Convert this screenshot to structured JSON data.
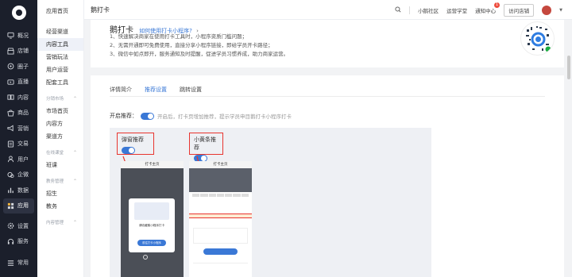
{
  "nav": {
    "items": [
      {
        "icon": "monitor-icon",
        "label": "概况"
      },
      {
        "icon": "store-icon",
        "label": "店铺"
      },
      {
        "icon": "group-icon",
        "label": "圈子"
      },
      {
        "icon": "live-icon",
        "label": "直播"
      },
      {
        "icon": "book-icon",
        "label": "内容"
      },
      {
        "icon": "goods-icon",
        "label": "商品"
      },
      {
        "icon": "marketing-icon",
        "label": "营销"
      },
      {
        "icon": "transaction-icon",
        "label": "交易"
      },
      {
        "icon": "user-icon",
        "label": "用户"
      },
      {
        "icon": "enterprise-wechat-icon",
        "label": "企微"
      },
      {
        "icon": "data-icon",
        "label": "数据"
      },
      {
        "icon": "apps-icon",
        "label": "应用"
      },
      {
        "icon": "settings-icon",
        "label": "设置"
      },
      {
        "icon": "service-icon",
        "label": "服务"
      }
    ],
    "bottom": {
      "icon": "menu-icon",
      "label": "常用"
    }
  },
  "subnav": {
    "top": "应用首页",
    "items": [
      "经营渠道",
      "内容工具",
      "营销玩法",
      "用户运营",
      "配套工具"
    ],
    "selected": "内容工具",
    "groups": [
      {
        "title": "分销市场",
        "items": [
          "市场首页",
          "内容方",
          "渠道方"
        ]
      },
      {
        "title": "在线课堂",
        "items": [
          "班课"
        ]
      },
      {
        "title": "教务管理",
        "items": [
          "招生",
          "教务"
        ]
      },
      {
        "title": "内容管理",
        "items": []
      }
    ]
  },
  "topbar": {
    "title": "鹅打卡",
    "community": "小鹅社区",
    "academy": "运营学堂",
    "notice": "通知中心",
    "notice_badge": "1",
    "visit": "访问店铺"
  },
  "intro": {
    "title": "鹅打卡",
    "help_link": "如何使用打卡小程序?",
    "lines": [
      "1、快速解决商家在使用打卡工具时，小程序资质门槛问题；",
      "2、无需开通即可免费使用，直接分享小程序链接，即给学员开卡路径；",
      "3、微信中如点即开，服务通知及时提醒，促进学员习惯养成，助力商家运营。"
    ]
  },
  "settings": {
    "tabs": [
      "详情简介",
      "推荐设置",
      "跳转设置"
    ],
    "active_tab": "推荐设置",
    "open_label": "开启推荐：",
    "open_hint": "开启后，打卡页增加推荐，提示学员申目鹅打卡小程序打卡",
    "options": [
      {
        "label": "弹窗推荐",
        "on": true
      },
      {
        "label": "小黄条推荐",
        "on": true
      }
    ],
    "phone_title": "打卡主页",
    "popup_text": "请收藏鹅小程序打卡",
    "popup_btn": "前往打卡小程序",
    "banner_text": "打卡主页"
  },
  "colors": {
    "accent": "#3a78d6",
    "nav_bg": "#1b1f2b",
    "highlight": "#e8352f"
  }
}
